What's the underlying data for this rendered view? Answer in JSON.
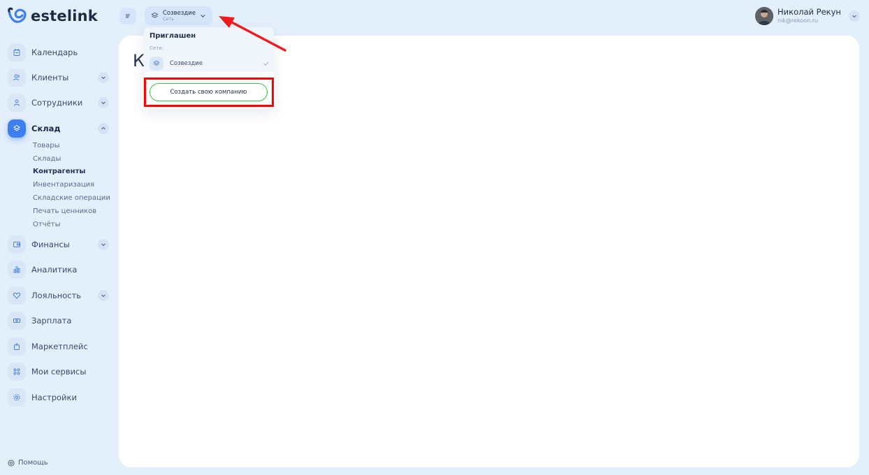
{
  "app": {
    "logo_text": "estelink"
  },
  "sidebar": {
    "items": [
      {
        "label": "Календарь",
        "icon": "calendar-icon"
      },
      {
        "label": "Клиенты",
        "icon": "users-icon"
      },
      {
        "label": "Сотрудники",
        "icon": "employee-icon"
      },
      {
        "label": "Склад",
        "icon": "warehouse-icon"
      },
      {
        "label": "Финансы",
        "icon": "wallet-icon"
      },
      {
        "label": "Аналитика",
        "icon": "chart-icon"
      },
      {
        "label": "Лояльность",
        "icon": "heart-icon"
      },
      {
        "label": "Зарплата",
        "icon": "money-icon"
      },
      {
        "label": "Маркетплейс",
        "icon": "bag-icon"
      },
      {
        "label": "Мои сервисы",
        "icon": "services-icon"
      },
      {
        "label": "Настройки",
        "icon": "gear-icon"
      }
    ],
    "sklad_sub": [
      "Товары",
      "Склады",
      "Контрагенты",
      "Инвентаризация",
      "Складские операции",
      "Печать ценников",
      "Отчёты"
    ],
    "help": "Помощь"
  },
  "topbar": {
    "network_name": "Созвездие",
    "network_type": "Сеть"
  },
  "user": {
    "name": "Николай Рекун",
    "email": "nik@rekoon.ru"
  },
  "main": {
    "title": "К"
  },
  "dropdown": {
    "heading": "Приглашен",
    "subheading": "Сети:",
    "item": "Созвездие",
    "create_button": "Создать свою компанию"
  },
  "colors": {
    "accent": "#3d7ff0",
    "background": "#e4effc",
    "highlight": "#ff0000",
    "success_border": "#3ec04a"
  }
}
